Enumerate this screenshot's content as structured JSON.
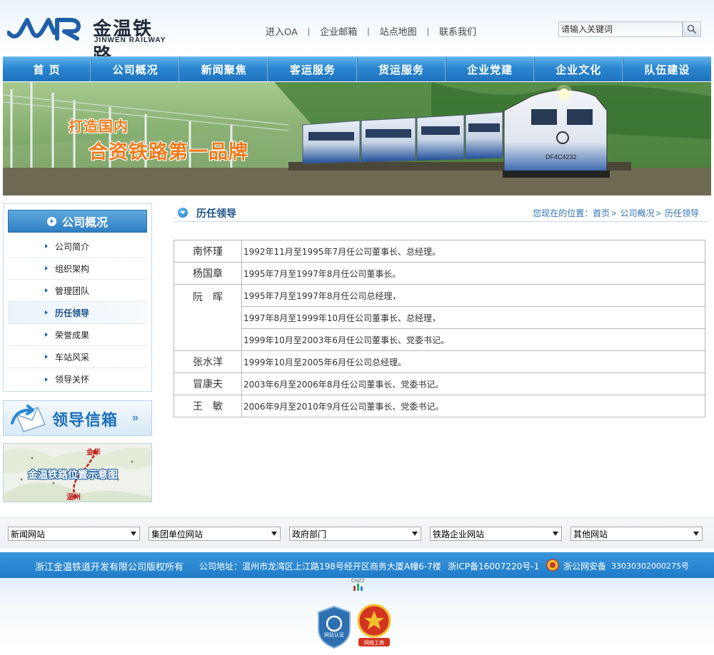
{
  "header": {
    "logo_cn": "金温铁路",
    "logo_en": "JINWEN RAILWAY",
    "top_links": [
      "进入OA",
      "企业邮箱",
      "站点地图",
      "联系我们"
    ],
    "search_placeholder": "请输入关键词",
    "search_icon": "search-icon"
  },
  "nav": {
    "items": [
      "首 页",
      "公司概况",
      "新闻聚焦",
      "客运服务",
      "货运服务",
      "企业党建",
      "企业文化",
      "队伍建设"
    ]
  },
  "banner": {
    "slogan_line1": "打造国内",
    "slogan_line2": "合资铁路第一品牌",
    "locomotive_number": "DF4C4232"
  },
  "sidebar": {
    "title": "公司概况",
    "items": [
      {
        "label": "公司简介",
        "active": false
      },
      {
        "label": "组织架构",
        "active": false
      },
      {
        "label": "管理团队",
        "active": false
      },
      {
        "label": "历任领导",
        "active": true
      },
      {
        "label": "荣誉成果",
        "active": false
      },
      {
        "label": "车站风采",
        "active": false
      },
      {
        "label": "领导关怀",
        "active": false
      }
    ],
    "leader_mail": "领导信箱",
    "leader_mail_arrows": "»",
    "map_title": "金温铁路位置示意图",
    "map_city_north": "金华",
    "map_city_south": "温州"
  },
  "content": {
    "title": "历任领导",
    "breadcrumb_prefix": "您现在的位置：",
    "breadcrumb": [
      "首页",
      "公司概况",
      "历任领导"
    ],
    "leaders": [
      {
        "name": "南怀瑾",
        "terms": [
          "1992年11月至1995年7月任公司董事长、总经理。"
        ]
      },
      {
        "name": "杨国章",
        "terms": [
          "1995年7月至1997年8月任公司董事长。"
        ]
      },
      {
        "name": "阮　晖",
        "terms": [
          "1995年7月至1997年8月任公司总经理，",
          "1997年8月至1999年10月任公司董事长、总经理，",
          "1999年10月至2003年6月任公司董事长、党委书记。"
        ]
      },
      {
        "name": "张水洋",
        "terms": [
          "1999年10月至2005年6月任公司总经理。"
        ]
      },
      {
        "name": "冒康夫",
        "terms": [
          "2003年6月至2006年8月任公司董事长、党委书记。"
        ]
      },
      {
        "name": "王　敏",
        "terms": [
          "2006年9月至2010年9月任公司董事长、党委书记。"
        ]
      }
    ]
  },
  "links_bar": {
    "selects": [
      "新闻网站",
      "集团单位网站",
      "政府部门",
      "铁路企业网站",
      "其他网站"
    ]
  },
  "footer": {
    "copyright": "浙江金温铁道开发有限公司版权所有",
    "address": "公司地址：温州市龙湾区上江路198号经开区商务大厦A幢6-7楼",
    "icp": "浙ICP备16007220号-1",
    "police_text": "浙公网安备",
    "police_number": "33030302000275号",
    "cnzz": "CNZZ",
    "badge1_text": "网站认证",
    "badge2_text": "网络工商"
  },
  "colors": {
    "nav_blue": "#2a86d1",
    "link_blue": "#2c6fb5",
    "slogan_orange": "#f07a1a",
    "footer_blue": "#1f7bc8"
  }
}
